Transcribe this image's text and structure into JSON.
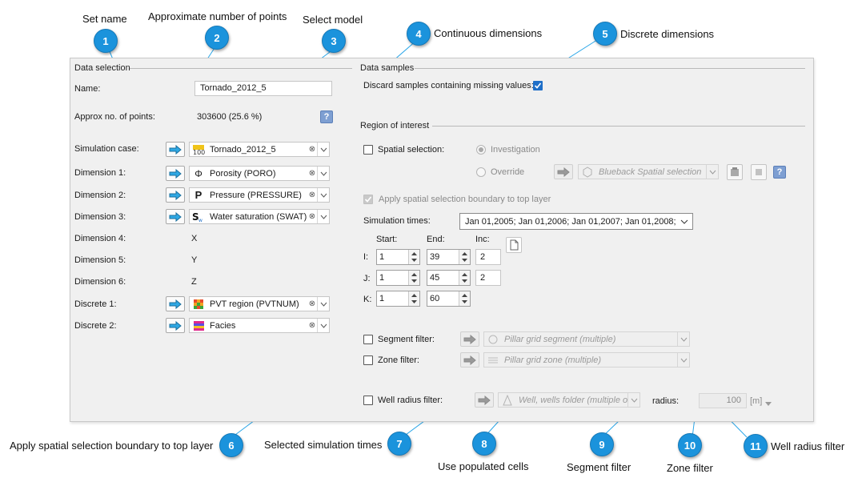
{
  "callouts": {
    "set_name": "Set name",
    "approx_points": "Approximate number of points",
    "select_model": "Select model",
    "continuous": "Continuous dimensions",
    "discrete": "Discrete dimensions",
    "apply_boundary": "Apply spatial selection boundary to top layer",
    "sim_times": "Selected simulation times",
    "populated": "Use populated cells",
    "segment": "Segment filter",
    "zone": "Zone filter",
    "well_radius": "Well radius filter",
    "n1": "1",
    "n2": "2",
    "n3": "3",
    "n4": "4",
    "n5": "5",
    "n6": "6",
    "n7": "7",
    "n8": "8",
    "n9": "9",
    "n10": "10",
    "n11": "11"
  },
  "data_selection": {
    "title": "Data selection",
    "name_label": "Name:",
    "name_value": "Tornado_2012_5",
    "approx_label": "Approx no. of points:",
    "approx_value": "303600 (25.6 %)",
    "help": "?",
    "sim_case_label": "Simulation case:",
    "sim_case_value": "Tornado_2012_5",
    "dim1_label": "Dimension 1:",
    "dim1_value": "Porosity (PORO)",
    "dim2_label": "Dimension 2:",
    "dim2_value": "Pressure (PRESSURE)",
    "dim3_label": "Dimension 3:",
    "dim3_value": "Water saturation (SWAT)",
    "dim4_label": "Dimension 4:",
    "dim4_value": "X",
    "dim5_label": "Dimension 5:",
    "dim5_value": "Y",
    "dim6_label": "Dimension 6:",
    "dim6_value": "Z",
    "disc1_label": "Discrete 1:",
    "disc1_value": "PVT region (PVTNUM)",
    "disc2_label": "Discrete 2:",
    "disc2_value": "Facies"
  },
  "data_samples": {
    "title": "Data samples",
    "discard_label": "Discard samples containing missing values:",
    "discard_checked": true
  },
  "region": {
    "title": "Region of interest",
    "spatial_label": "Spatial selection:",
    "investigation": "Investigation",
    "override": "Override",
    "spatial_combo": "Blueback Spatial selection",
    "help": "?",
    "apply_label": "Apply spatial selection boundary to top layer",
    "sim_times_label": "Simulation times:",
    "sim_times_value": "Jan 01,2005; Jan 01,2006; Jan 01,2007; Jan 01,2008;",
    "start": "Start:",
    "end": "End:",
    "inc": "Inc:",
    "i": "I:",
    "j": "J:",
    "k": "K:",
    "i_start": "1",
    "i_end": "39",
    "i_inc": "2",
    "j_start": "1",
    "j_end": "45",
    "j_inc": "2",
    "k_start": "1",
    "k_end": "60",
    "segment_label": "Segment filter:",
    "segment_combo": "Pillar grid segment (multiple)",
    "zone_label": "Zone filter:",
    "zone_combo": "Pillar grid zone (multiple)",
    "well_label": "Well radius filter:",
    "well_combo": "Well, wells folder (multiple or",
    "radius_label": "radius:",
    "radius_value": "100",
    "radius_unit": "[m]"
  }
}
